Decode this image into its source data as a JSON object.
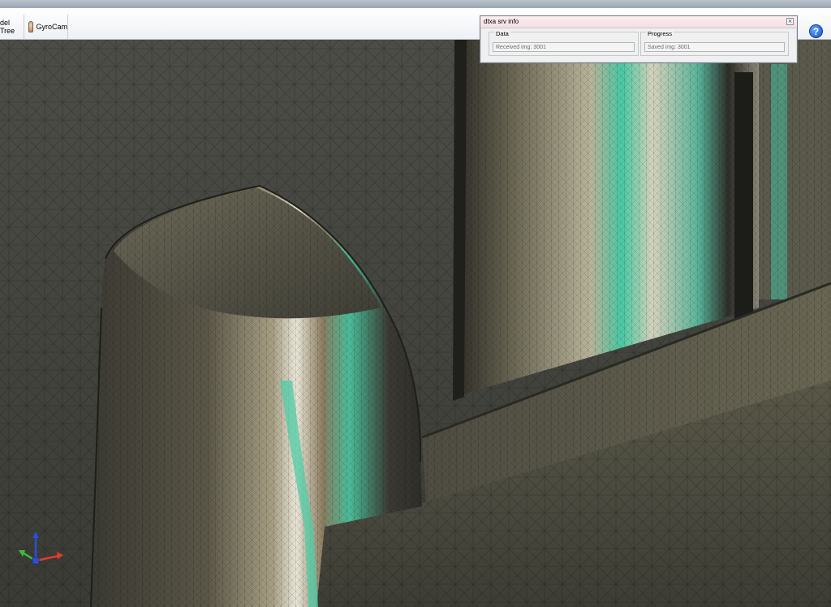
{
  "toolbar": {
    "tabs": [
      {
        "label": "del Tree"
      },
      {
        "label": "GyroCam"
      }
    ],
    "help_symbol": "?"
  },
  "viewport": {
    "axis_triad": {
      "x_color": "#e23b2b",
      "y_color": "#3bbd3b",
      "z_color": "#2a4fd8"
    }
  },
  "info_panel": {
    "title": "dtxa srv info",
    "close_symbol": "⨯",
    "groups": [
      {
        "label": "Data",
        "value": "Received img: 3001"
      },
      {
        "label": "Progress",
        "value": "Saved img: 3001"
      }
    ]
  }
}
